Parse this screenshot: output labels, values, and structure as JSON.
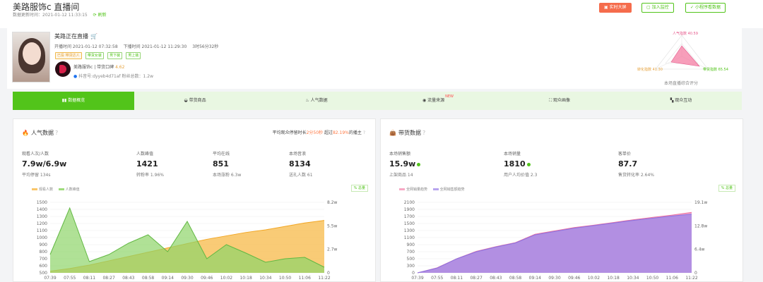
{
  "header": {
    "title": "美路服饰c  直播间",
    "sub": "数据更新时间：2021-01-12 11:33:15",
    "refresh": "刷新",
    "buttons": [
      "实时大屏",
      "加入监控",
      "小程序看数据"
    ]
  },
  "live": {
    "name": "美路正在直播",
    "start": "开播时间 2021-01-12 07:32:58",
    "end": "下播时间 2021-01-12 11:29:30",
    "duration": "3时56分32秒",
    "tags": [
      "已投 带货达人",
      "带货女装",
      "男下装",
      "男上装"
    ],
    "shop_line": "美路服饰c  |  带货口碑",
    "shop_score": "4.62",
    "douyin": "抖音号:dyyeb4d71af   粉丝总数：1.2w"
  },
  "radar": {
    "labels": [
      "人气指数 40.59",
      "转化指数 41.30",
      "带货指数 65.54"
    ],
    "caption": "本场直播综合评分",
    "values": [
      40.59,
      41.3,
      65.54
    ]
  },
  "nav": {
    "tabs": [
      "数据概览",
      "带货商品",
      "人气数据",
      "流量来源",
      "观众画像",
      "观众互动"
    ],
    "new_badge": "NEW",
    "active": 0
  },
  "left_panel": {
    "title": "人气数据",
    "rank_prefix": "平均观众停留时长",
    "rank_time": "2分50秒",
    "rank_mid": " 超过",
    "rank_pct": "82.19%",
    "rank_suffix": "的播主",
    "stats": [
      {
        "label": "观看人次/人数",
        "value": "7.9w/6.9w",
        "sub": "平均停留 134s"
      },
      {
        "label": "人数峰值",
        "value": "1421",
        "sub": "转粉率 1.96%"
      },
      {
        "label": "平均在线",
        "value": "851",
        "sub": "本场涨粉 6.3w"
      },
      {
        "label": "本场音浪",
        "value": "8134",
        "sub": "送礼人数 61"
      }
    ],
    "legend": [
      "观看人数",
      "人数峰值"
    ],
    "total_btn": "总量"
  },
  "right_panel": {
    "title": "带货数据",
    "stats": [
      {
        "label": "本场销售额",
        "value": "15.9w",
        "sub": "上架商品 14"
      },
      {
        "label": "本场销量",
        "value": "1810",
        "sub": "用户人均价值 2.3"
      },
      {
        "label": "客单价",
        "value": "87.7",
        "sub": "售货转化率 2.64%"
      }
    ],
    "legend": [
      "全网销量趋势",
      "全网销售额趋势"
    ],
    "total_btn": "总量"
  },
  "chart_data": [
    {
      "type": "area",
      "x": [
        "07:39",
        "07:55",
        "08:11",
        "08:27",
        "08:43",
        "08:58",
        "09:14",
        "09:30",
        "09:46",
        "10:02",
        "10:18",
        "10:34",
        "10:50",
        "11:06",
        "11:22"
      ],
      "series": [
        {
          "name": "观看人数",
          "axis": "right",
          "values": [
            0.2,
            0.5,
            0.9,
            1.4,
            1.9,
            2.4,
            2.9,
            3.4,
            3.9,
            4.3,
            4.7,
            5.0,
            5.4,
            5.8,
            6.1
          ]
        },
        {
          "name": "人数峰值",
          "axis": "left",
          "values": [
            760,
            1420,
            660,
            760,
            920,
            1040,
            800,
            1230,
            700,
            900,
            780,
            650,
            700,
            720,
            580
          ]
        }
      ],
      "ylim": [
        500,
        1500
      ],
      "yticks": [
        "500",
        "600",
        "700",
        "800",
        "900",
        "1000",
        "1100",
        "1200",
        "1300",
        "1400",
        "1500"
      ],
      "y2ticks": [
        "0",
        "2.7w",
        "5.5w",
        "8.2w"
      ],
      "y2lim": [
        0,
        8.2
      ]
    },
    {
      "type": "area",
      "x": [
        "07:39",
        "07:55",
        "08:11",
        "08:27",
        "08:43",
        "08:58",
        "09:14",
        "09:30",
        "09:46",
        "10:02",
        "10:18",
        "10:34",
        "10:50",
        "11:06",
        "11:22"
      ],
      "series": [
        {
          "name": "全网销量趋势",
          "axis": "left",
          "values": [
            0,
            150,
            420,
            640,
            780,
            900,
            1150,
            1250,
            1350,
            1420,
            1500,
            1580,
            1650,
            1720,
            1800
          ]
        },
        {
          "name": "全网销售额趋势",
          "axis": "right",
          "values": [
            0,
            1.3,
            3.8,
            5.7,
            7.0,
            8.1,
            10.3,
            11.2,
            12.1,
            12.8,
            13.5,
            14.2,
            14.8,
            15.4,
            15.9
          ]
        }
      ],
      "ylim": [
        0,
        2100
      ],
      "yticks": [
        "0",
        "300",
        "500",
        "700",
        "900",
        "1100",
        "1300",
        "1500",
        "1700",
        "1900",
        "2100"
      ],
      "y2ticks": [
        "0",
        "6.4w",
        "12.8w",
        "19.1w"
      ],
      "y2lim": [
        0,
        19.1
      ]
    }
  ]
}
